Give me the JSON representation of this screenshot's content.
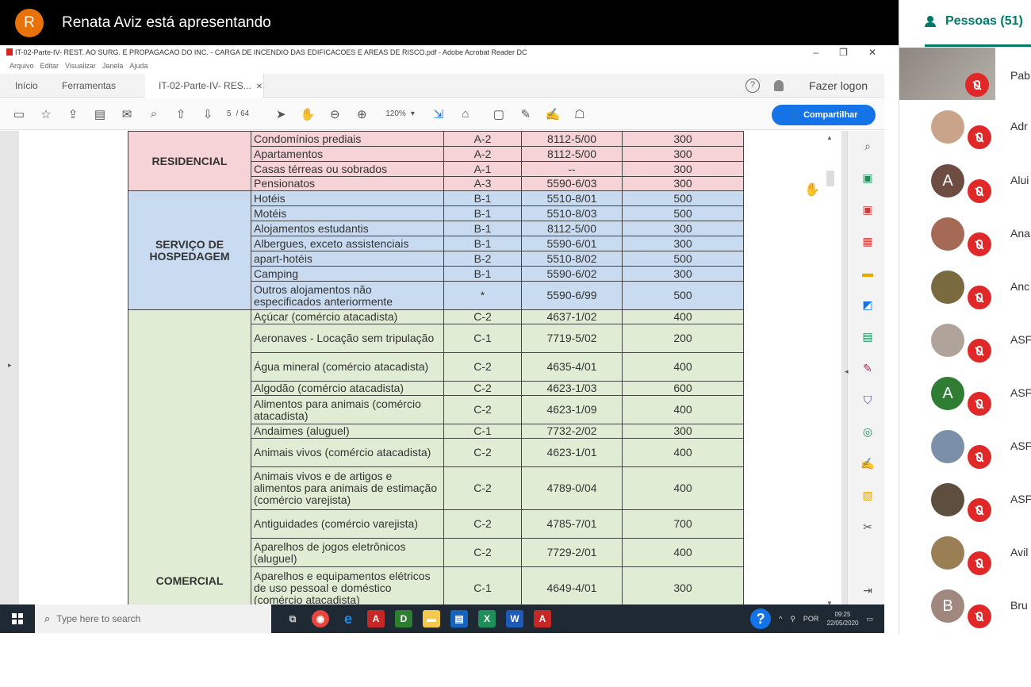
{
  "presenter": {
    "initial": "R",
    "text": "Renata Aviz está apresentando"
  },
  "acrobat": {
    "window_title": "IT-02-Parte-IV- REST. AO SURG. E PROPAGACAO DO INC. - CARGA DE INCENDIO DAS EDIFICACOES E AREAS DE RISCO.pdf - Adobe Acrobat Reader DC",
    "menu": [
      "Arquivo",
      "Editar",
      "Visualizar",
      "Janela",
      "Ajuda"
    ],
    "tabs": {
      "home": "Início",
      "tools": "Ferramentas",
      "document": "IT-02-Parte-IV- RES..."
    },
    "login": "Fazer logon",
    "page_current": "5",
    "page_total": "/ 64",
    "zoom": "120%",
    "share_label": "Compartilhar"
  },
  "table": {
    "residencial": {
      "category": "RESIDENCIAL",
      "rows": [
        {
          "desc": "Condomínios prediais",
          "div": "A-2",
          "cnae": "8112-5/00",
          "load": "300"
        },
        {
          "desc": "Apartamentos",
          "div": "A-2",
          "cnae": "8112-5/00",
          "load": "300"
        },
        {
          "desc": "Casas térreas ou sobrados",
          "div": "A-1",
          "cnae": "--",
          "load": "300"
        },
        {
          "desc": "Pensionatos",
          "div": "A-3",
          "cnae": "5590-6/03",
          "load": "300"
        }
      ]
    },
    "hospedagem": {
      "category": "SERVIÇO DE HOSPEDAGEM",
      "rows": [
        {
          "desc": "Hotéis",
          "div": "B-1",
          "cnae": "5510-8/01",
          "load": "500"
        },
        {
          "desc": "Motéis",
          "div": "B-1",
          "cnae": "5510-8/03",
          "load": "500"
        },
        {
          "desc": "Alojamentos estudantis",
          "div": "B-1",
          "cnae": "8112-5/00",
          "load": "300"
        },
        {
          "desc": "Albergues, exceto assistenciais",
          "div": "B-1",
          "cnae": "5590-6/01",
          "load": "300"
        },
        {
          "desc": "apart-hotéis",
          "div": "B-2",
          "cnae": "5510-8/02",
          "load": "500"
        },
        {
          "desc": "Camping",
          "div": "B-1",
          "cnae": "5590-6/02",
          "load": "300"
        },
        {
          "desc": "Outros alojamentos não especificados anteriormente",
          "div": "*",
          "cnae": "5590-6/99",
          "load": "500"
        }
      ]
    },
    "comercial": {
      "category": "COMERCIAL",
      "rows": [
        {
          "desc": "Açúcar (comércio atacadista)",
          "div": "C-2",
          "cnae": "4637-1/02",
          "load": "400"
        },
        {
          "desc": "Aeronaves - Locação sem tripulação",
          "div": "C-1",
          "cnae": "7719-5/02",
          "load": "200"
        },
        {
          "desc": "Água mineral (comércio atacadista)",
          "div": "C-2",
          "cnae": "4635-4/01",
          "load": "400"
        },
        {
          "desc": "Algodão (comércio atacadista)",
          "div": "C-2",
          "cnae": "4623-1/03",
          "load": "600"
        },
        {
          "desc": "Alimentos para animais (comércio atacadista)",
          "div": "C-2",
          "cnae": "4623-1/09",
          "load": "400"
        },
        {
          "desc": "Andaimes (aluguel)",
          "div": "C-1",
          "cnae": "7732-2/02",
          "load": "300"
        },
        {
          "desc": "Animais vivos (comércio atacadista)",
          "div": "C-2",
          "cnae": "4623-1/01",
          "load": "400"
        },
        {
          "desc": "Animais vivos e de artigos e alimentos para animais de estimação (comércio varejista)",
          "div": "C-2",
          "cnae": "4789-0/04",
          "load": "400"
        },
        {
          "desc": "Antiguidades (comércio varejista)",
          "div": "C-2",
          "cnae": "4785-7/01",
          "load": "700"
        },
        {
          "desc": "Aparelhos de jogos eletrônicos (aluguel)",
          "div": "C-2",
          "cnae": "7729-2/01",
          "load": "400"
        },
        {
          "desc": "Aparelhos e equipamentos elétricos de uso pessoal e doméstico (comércio atacadista)",
          "div": "C-1",
          "cnae": "4649-4/01",
          "load": "300"
        }
      ]
    }
  },
  "taskbar": {
    "search_placeholder": "Type here to search",
    "lang": "POR",
    "time": "09:25",
    "date": "22/05/2020"
  },
  "people": {
    "tab_label": "Pessoas (51)",
    "participants": [
      {
        "name": "Pab",
        "initial": "",
        "color": "#8d8680"
      },
      {
        "name": "Adr",
        "initial": "",
        "color": "#c9a38a"
      },
      {
        "name": "Alui",
        "initial": "A",
        "color": "#6d4c41"
      },
      {
        "name": "Ana",
        "initial": "",
        "color": "#a56a55"
      },
      {
        "name": "Anc",
        "initial": "",
        "color": "#7a6a40"
      },
      {
        "name": "ASF",
        "initial": "",
        "color": "#b0a49a"
      },
      {
        "name": "ASF",
        "initial": "A",
        "color": "#2e7d32"
      },
      {
        "name": "ASF",
        "initial": "",
        "color": "#7b8fa8"
      },
      {
        "name": "ASF",
        "initial": "",
        "color": "#5d4e3e"
      },
      {
        "name": "Avil",
        "initial": "",
        "color": "#9a7f55"
      },
      {
        "name": "Bru",
        "initial": "B",
        "color": "#a1887f"
      }
    ]
  }
}
